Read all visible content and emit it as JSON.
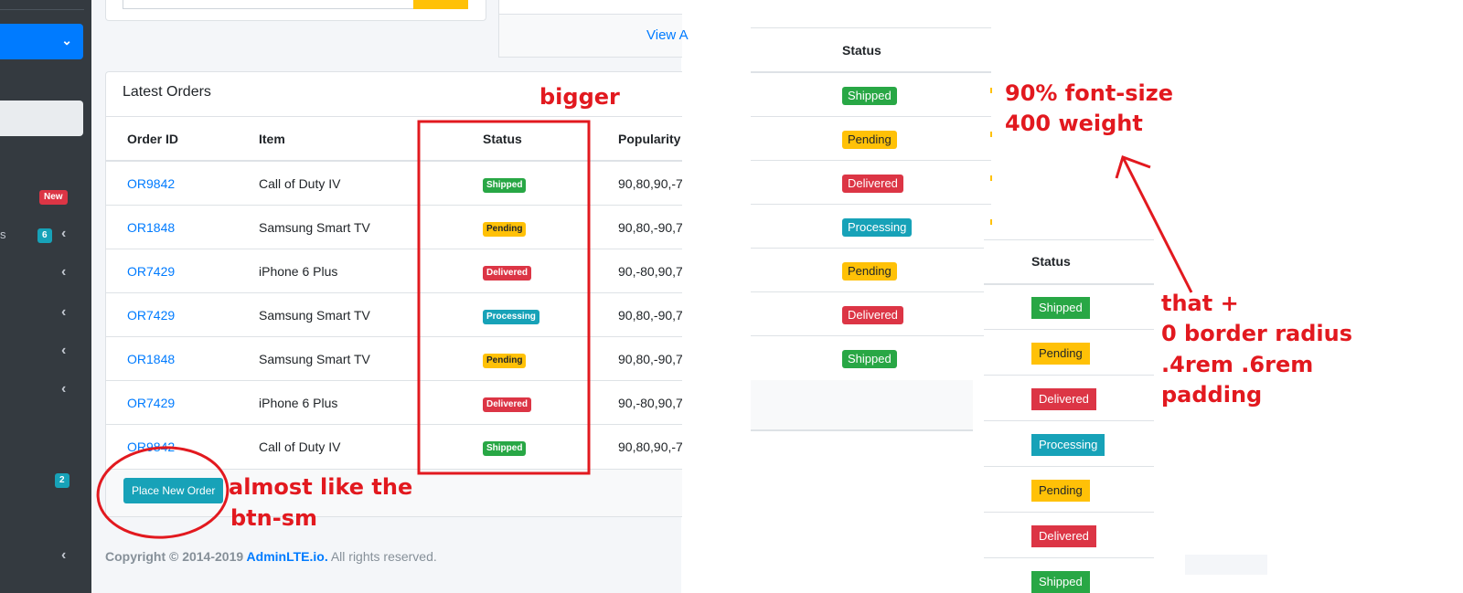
{
  "sidebar": {
    "badge_new": "New",
    "partial_label": "s",
    "badge_count_a": "6",
    "badge_count_b": "2",
    "colors": {
      "bg": "#343a40",
      "active": "#007bff",
      "new_badge": "#dc3545",
      "count_badge": "#17a2b8"
    }
  },
  "top_card": {
    "view_all_label": "View A"
  },
  "orders": {
    "title": "Latest Orders",
    "columns": [
      "Order ID",
      "Item",
      "Status",
      "Popularity"
    ],
    "rows": [
      {
        "id": "OR9842",
        "item": "Call of Duty IV",
        "status": "Shipped",
        "popularity": "90,80,90,-7"
      },
      {
        "id": "OR1848",
        "item": "Samsung Smart TV",
        "status": "Pending",
        "popularity": "90,80,-90,7"
      },
      {
        "id": "OR7429",
        "item": "iPhone 6 Plus",
        "status": "Delivered",
        "popularity": "90,-80,90,7"
      },
      {
        "id": "OR7429",
        "item": "Samsung Smart TV",
        "status": "Processing",
        "popularity": "90,80,-90,7"
      },
      {
        "id": "OR1848",
        "item": "Samsung Smart TV",
        "status": "Pending",
        "popularity": "90,80,-90,7"
      },
      {
        "id": "OR7429",
        "item": "iPhone 6 Plus",
        "status": "Delivered",
        "popularity": "90,-80,90,7"
      },
      {
        "id": "OR9842",
        "item": "Call of Duty IV",
        "status": "Shipped",
        "popularity": "90,80,90,-7"
      }
    ],
    "button_label": "Place New Order"
  },
  "footer": {
    "prefix": "Copyright © 2014-2019 ",
    "brand": "AdminLTE.io.",
    "suffix": " All rights reserved."
  },
  "middle_table": {
    "header": "Status",
    "badges": [
      "Shipped",
      "Pending",
      "Delivered",
      "Processing",
      "Pending",
      "Delivered",
      "Shipped"
    ]
  },
  "right_table": {
    "header": "Status",
    "badges": [
      "Shipped",
      "Pending",
      "Delivered",
      "Processing",
      "Pending",
      "Delivered",
      "Shipped"
    ]
  },
  "annotations": {
    "bigger": "bigger",
    "font_line1": "90% font-size",
    "font_line2": "400 weight",
    "btn_line1": "almost like the",
    "btn_line2": "btn-sm",
    "that_line1": "that +",
    "that_line2": "0 border radius",
    "that_line3": ".4rem .6rem",
    "that_line4": "padding",
    "color": "#e2191f"
  },
  "status_colors": {
    "Shipped": "#28a745",
    "Pending": "#ffc107",
    "Delivered": "#dc3545",
    "Processing": "#17a2b8"
  }
}
